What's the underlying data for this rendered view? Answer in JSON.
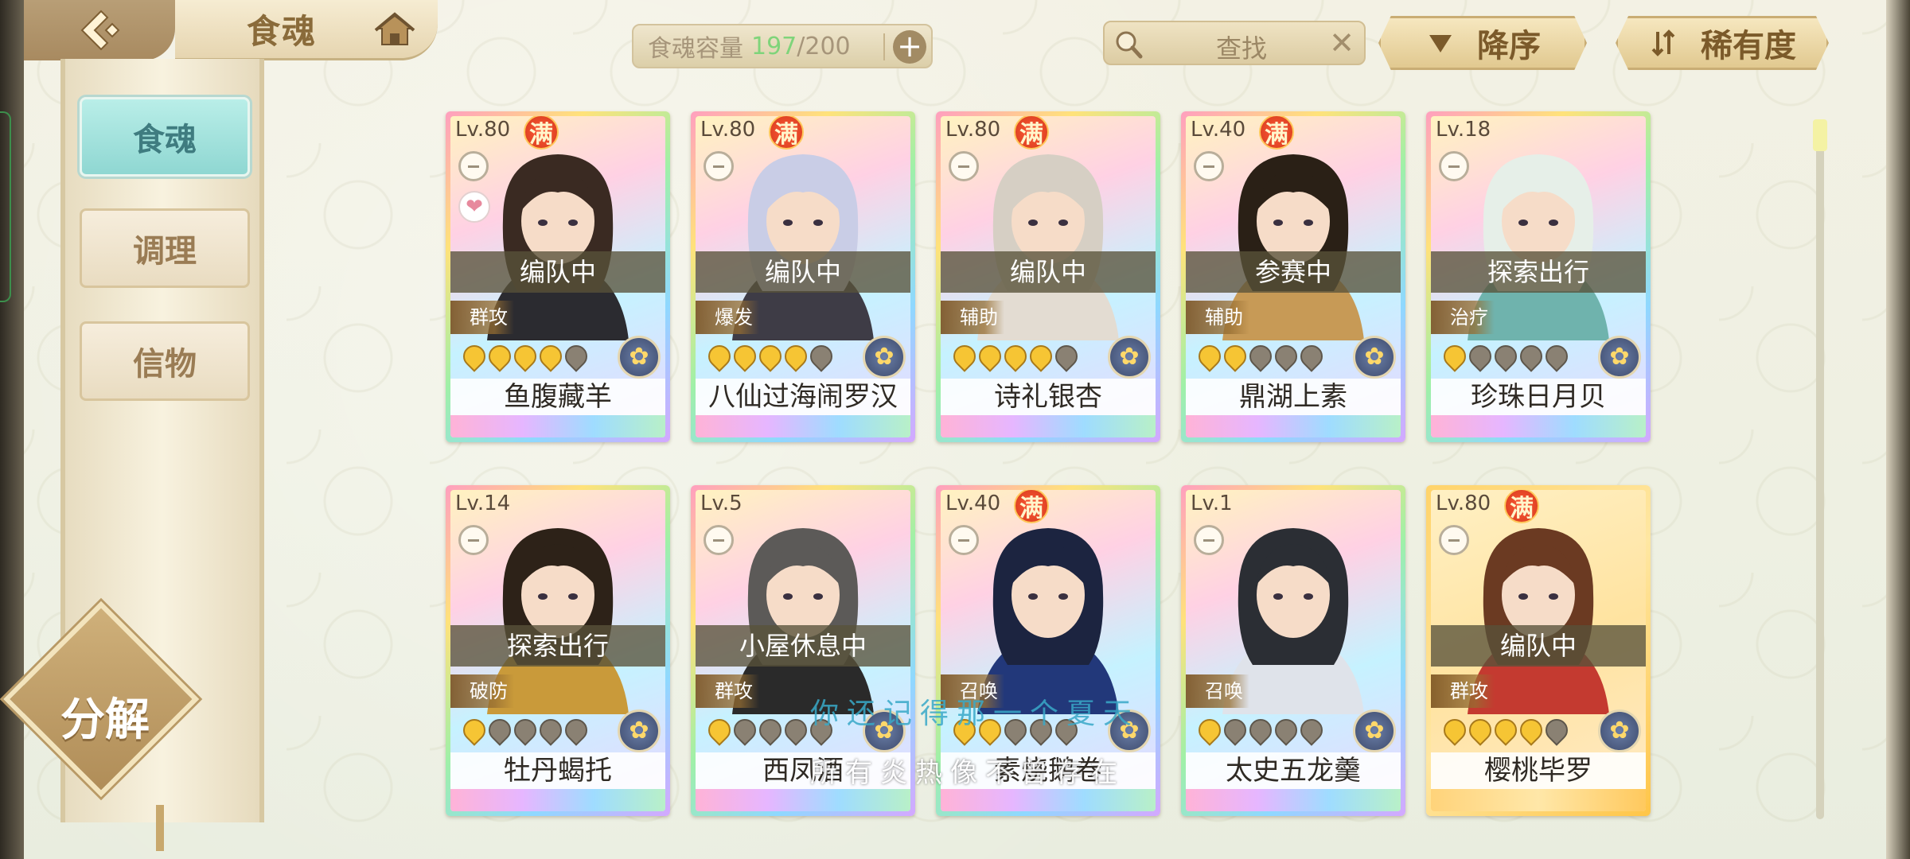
{
  "header": {
    "title": "食魂",
    "capacity_label": "食魂容量",
    "capacity_used": "197",
    "capacity_total": "/200",
    "capacity_add": "+",
    "search_placeholder": "查找",
    "search_clear": "✕",
    "sort_order_label": "降序",
    "sort_by_label": "稀有度"
  },
  "sidebar": {
    "tabs": [
      {
        "label": "食魂",
        "active": true
      },
      {
        "label": "调理",
        "active": false
      },
      {
        "label": "信物",
        "active": false
      }
    ],
    "decompose_label": "分解"
  },
  "cards": [
    {
      "level": "Lv.80",
      "full": "满",
      "status": "编队中",
      "role": "群攻",
      "stars_on": 4,
      "name": "鱼腹藏羊",
      "heart": "❤",
      "gold": false
    },
    {
      "level": "Lv.80",
      "full": "满",
      "status": "编队中",
      "role": "爆发",
      "stars_on": 4,
      "name": "八仙过海闹罗汉",
      "gold": false
    },
    {
      "level": "Lv.80",
      "full": "满",
      "status": "编队中",
      "role": "辅助",
      "stars_on": 4,
      "name": "诗礼银杏",
      "gold": false
    },
    {
      "level": "Lv.40",
      "full": "满",
      "status": "参赛中",
      "role": "辅助",
      "stars_on": 2,
      "name": "鼎湖上素",
      "gold": false
    },
    {
      "level": "Lv.18",
      "full": "",
      "status": "探索出行",
      "role": "治疗",
      "stars_on": 1,
      "name": "珍珠日月贝",
      "gold": false
    },
    {
      "level": "Lv.14",
      "full": "",
      "status": "探索出行",
      "role": "破防",
      "stars_on": 1,
      "name": "牡丹蝎托",
      "gold": false
    },
    {
      "level": "Lv.5",
      "full": "",
      "status": "小屋休息中",
      "role": "群攻",
      "stars_on": 1,
      "name": "西凤酒",
      "gold": false
    },
    {
      "level": "Lv.40",
      "full": "满",
      "status": "",
      "role": "召唤",
      "stars_on": 2,
      "name": "素烧鹅卷",
      "gold": false
    },
    {
      "level": "Lv.1",
      "full": "",
      "status": "",
      "role": "召唤",
      "stars_on": 1,
      "name": "太史五龙羹",
      "gold": false
    },
    {
      "level": "Lv.80",
      "full": "满",
      "status": "编队中",
      "role": "群攻",
      "stars_on": 4,
      "name": "樱桃毕罗",
      "gold": true
    }
  ],
  "overlay": {
    "line1": "你还记得那一个夏天",
    "line2": "所有炎热像不曾存在"
  },
  "colors": {
    "accent_teal": "#8fd7d2",
    "gold": "#c9ad74",
    "capacity_used": "#7fd47a"
  }
}
